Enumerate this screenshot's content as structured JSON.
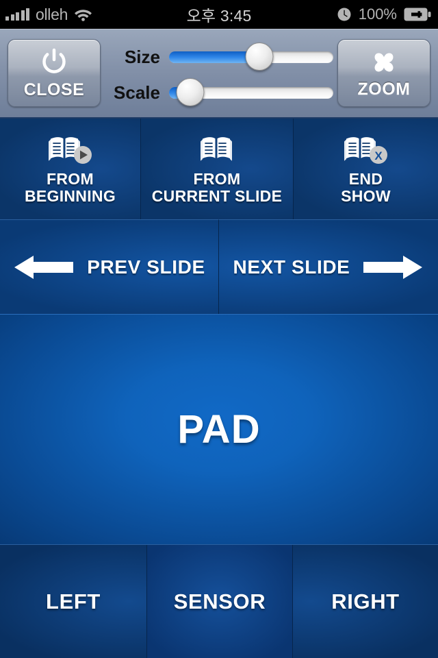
{
  "status_bar": {
    "carrier": "olleh",
    "wifi_icon": "wifi-icon",
    "signal_icon": "signal-bars-icon",
    "time": "오후 3:45",
    "alarm_icon": "alarm-clock-icon",
    "battery_percent": "100%",
    "battery_icon": "battery-charging-icon",
    "background_color": "#000000",
    "text_color": "#b4b4b4"
  },
  "toolbar": {
    "close_button": {
      "label": "CLOSE",
      "icon": "power-icon"
    },
    "zoom_button": {
      "label": "ZOOM",
      "icon": "clover-flower-icon"
    },
    "sliders": [
      {
        "label": "Size",
        "value_percent": 55,
        "fill_color": "#2f86e8",
        "name": "size-slider"
      },
      {
        "label": "Scale",
        "value_percent": 13,
        "fill_color": "#2f86e8",
        "name": "scale-slider"
      }
    ]
  },
  "show_controls": [
    {
      "label": "FROM\nBEGINNING",
      "icon": "book-play-icon",
      "badge": "play"
    },
    {
      "label": "FROM\nCURRENT SLIDE",
      "icon": "book-icon",
      "badge": ""
    },
    {
      "label": "END\nSHOW",
      "icon": "book-close-icon",
      "badge": "X"
    }
  ],
  "slide_nav": {
    "prev": {
      "label": "PREV SLIDE",
      "icon": "arrow-left-icon"
    },
    "next": {
      "label": "NEXT SLIDE",
      "icon": "arrow-right-icon"
    }
  },
  "pad": {
    "label": "PAD"
  },
  "mouse_buttons": [
    {
      "label": "LEFT"
    },
    {
      "label": "SENSOR"
    },
    {
      "label": "RIGHT"
    }
  ],
  "colors": {
    "panel_blue": "#0b3568",
    "panel_blue_light": "#14498c",
    "pad_blue": "#0f63bb",
    "toolbar_gray": "#8290a8",
    "accent": "#2f86e8"
  }
}
